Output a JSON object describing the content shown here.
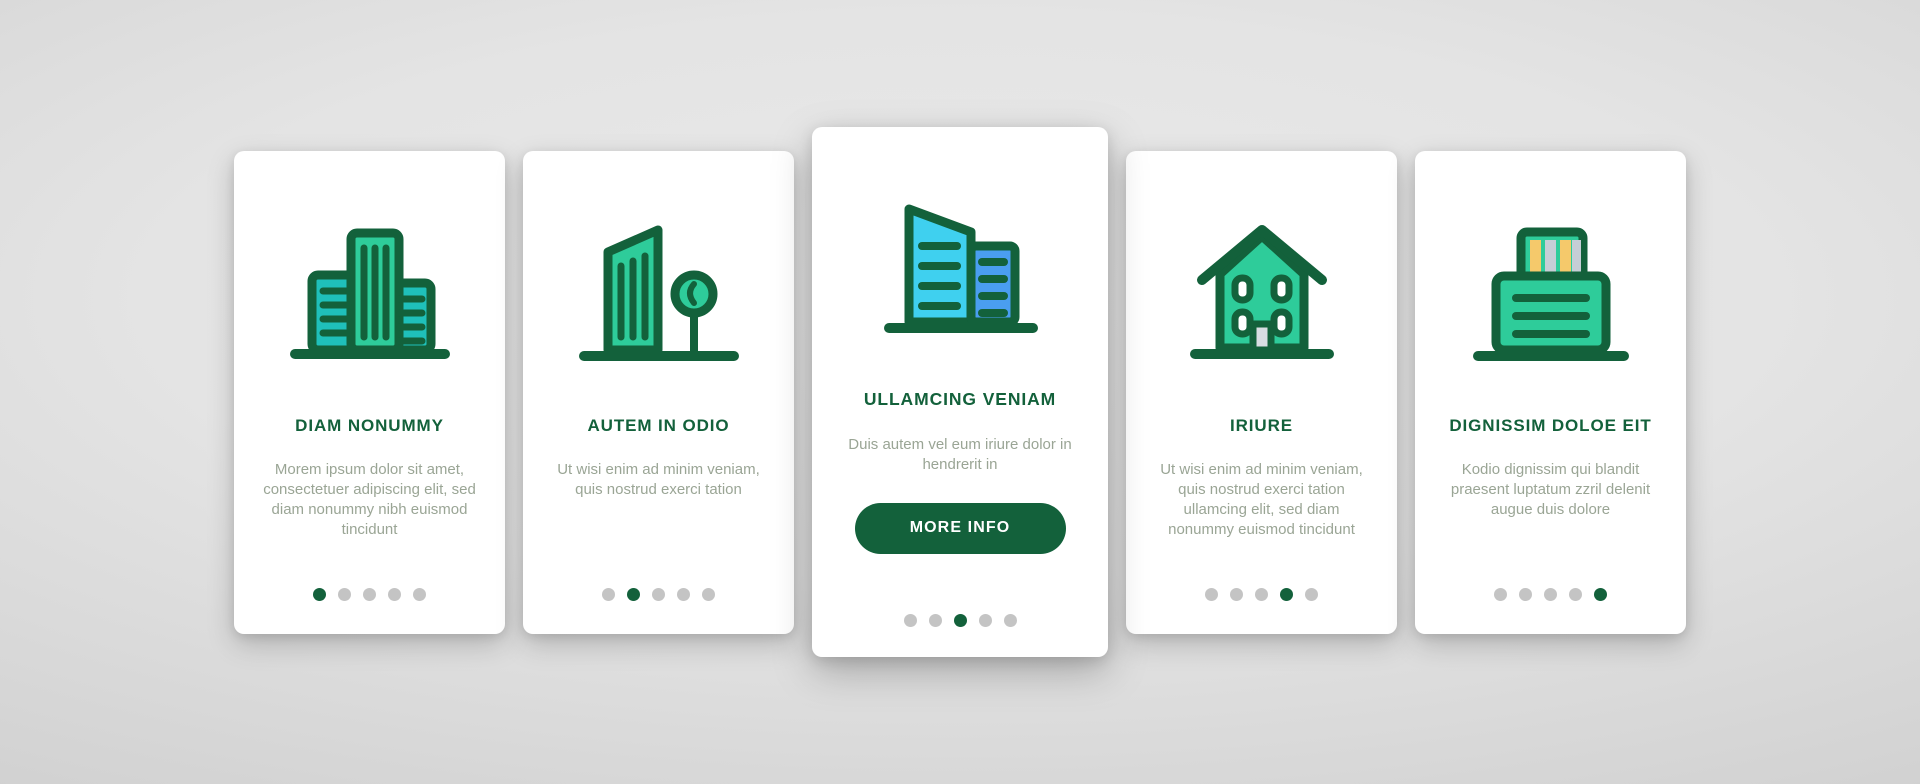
{
  "theme": {
    "accent_dark_green": "#13613b",
    "accent_green": "#2ecc9a",
    "accent_teal": "#1fc0ba",
    "accent_cyan": "#3fd0ef",
    "accent_blue": "#4a9ef0",
    "accent_yellow": "#f5c96b",
    "accent_gray_bar": "#c6ced6",
    "body_text_color": "#9aa595",
    "dot_inactive": "#c4c4c4",
    "card_background": "#ffffff",
    "page_background": "#d2d2d2"
  },
  "cards": [
    {
      "id": "card-1",
      "icon": "city-skyline-icon",
      "title": "DIAM NONUMMY",
      "body": "Morem ipsum dolor sit amet, consectetuer adipiscing elit, sed diam nonummy nibh euismod tincidunt",
      "dots": {
        "count": 5,
        "active_index": 0
      },
      "has_button": false,
      "featured": false
    },
    {
      "id": "card-2",
      "icon": "tower-with-tree-icon",
      "title": "AUTEM IN ODIO",
      "body": "Ut wisi enim ad minim veniam, quis nostrud exerci tation",
      "dots": {
        "count": 5,
        "active_index": 1
      },
      "has_button": false,
      "featured": false
    },
    {
      "id": "card-3",
      "icon": "blue-office-towers-icon",
      "title": "ULLAMCING VENIAM",
      "body": "Duis autem vel eum iriure dolor in hendrerit in",
      "button_label": "MORE INFO",
      "dots": {
        "count": 5,
        "active_index": 2
      },
      "has_button": true,
      "featured": true
    },
    {
      "id": "card-4",
      "icon": "house-icon",
      "title": "IRIURE",
      "body": "Ut wisi enim ad minim veniam, quis nostrud exerci tation ullamcing elit, sed diam nonummy euismod tincidunt",
      "dots": {
        "count": 5,
        "active_index": 3
      },
      "has_button": false,
      "featured": false
    },
    {
      "id": "card-5",
      "icon": "building-with-rooftop-icon",
      "title": "DIGNISSIM DOLOE EIT",
      "body": "Kodio dignissim qui blandit praesent luptatum zzril delenit augue duis dolore",
      "dots": {
        "count": 5,
        "active_index": 4
      },
      "has_button": false,
      "featured": false
    }
  ]
}
